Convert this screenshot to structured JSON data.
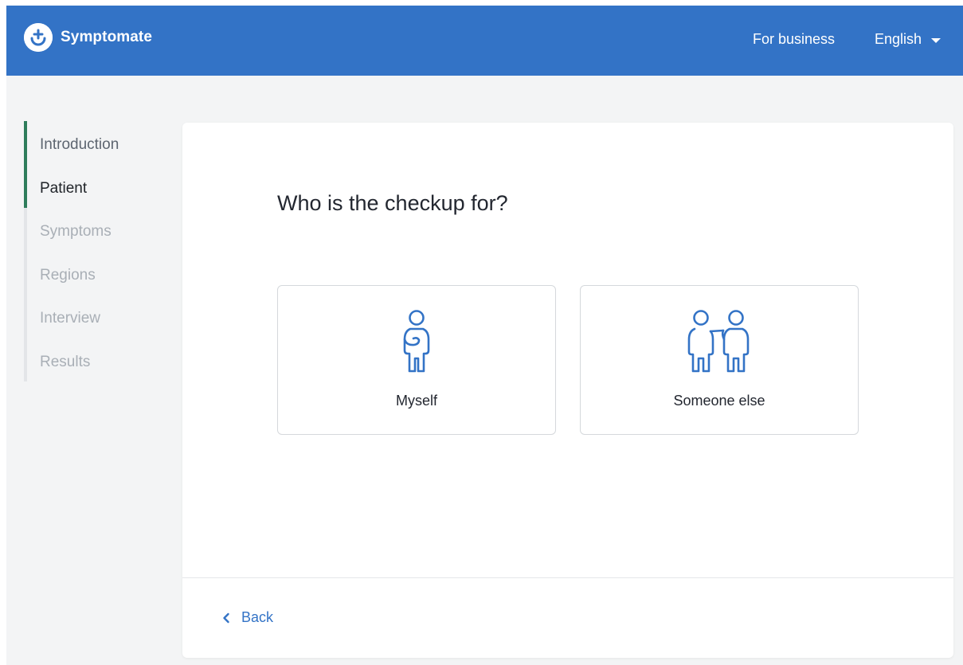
{
  "header": {
    "brand": "Symptomate",
    "nav": {
      "business": "For business",
      "language": "English"
    }
  },
  "steps": [
    {
      "label": "Introduction",
      "state": "done"
    },
    {
      "label": "Patient",
      "state": "active"
    },
    {
      "label": "Symptoms",
      "state": "todo"
    },
    {
      "label": "Regions",
      "state": "todo"
    },
    {
      "label": "Interview",
      "state": "todo"
    },
    {
      "label": "Results",
      "state": "todo"
    }
  ],
  "main": {
    "question": "Who is the checkup for?",
    "options": [
      {
        "label": "Myself",
        "icon": "person-icon"
      },
      {
        "label": "Someone else",
        "icon": "two-people-icon"
      }
    ],
    "back_label": "Back"
  },
  "colors": {
    "header_bg": "#3373c6",
    "accent": "#3373c6",
    "progress": "#2e7d5b",
    "page_bg": "#f3f4f5"
  }
}
